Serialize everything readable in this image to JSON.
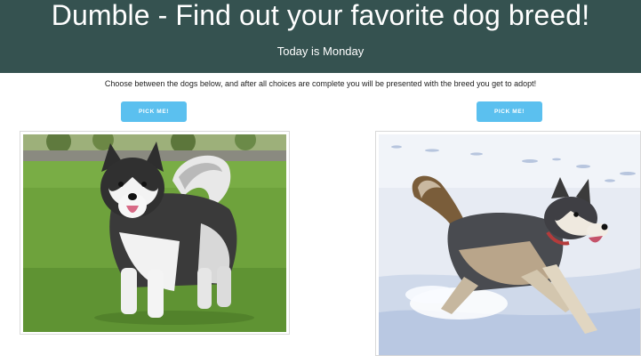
{
  "header": {
    "title": "Dumble - Find out your favorite dog breed!",
    "subtitle": "Today is Monday"
  },
  "instructions": "Choose between the dogs below, and after all choices are complete you will be presented with the breed you get to adopt!",
  "choices": [
    {
      "button_label": "PICK ME!",
      "photo": "malamute-dog-photo"
    },
    {
      "button_label": "PICK ME!",
      "photo": "husky-dog-photo"
    }
  ],
  "colors": {
    "header_bg": "#355250",
    "button_bg": "#5bc0ef",
    "text_on_dark": "#ffffff"
  }
}
